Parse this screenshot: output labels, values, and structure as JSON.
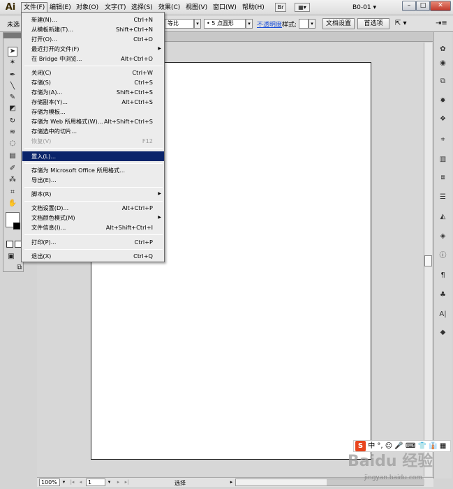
{
  "app": {
    "logo": "Ai",
    "workspace": "B0-01"
  },
  "menubar": {
    "items": [
      {
        "label": "文件(F)"
      },
      {
        "label": "编辑(E)"
      },
      {
        "label": "对象(O)"
      },
      {
        "label": "文字(T)"
      },
      {
        "label": "选择(S)"
      },
      {
        "label": "效果(C)"
      },
      {
        "label": "视图(V)"
      },
      {
        "label": "窗口(W)"
      },
      {
        "label": "帮助(H)"
      }
    ],
    "icons": [
      "bridge-icon",
      "arrange-documents-icon"
    ]
  },
  "window_controls": {
    "minimize": "–",
    "maximize": "□",
    "close": "✕"
  },
  "controlbar": {
    "selection_label": "未选",
    "stroke_profile": "等比",
    "brush": "• 5 点圆形",
    "opacity_label": "不透明度",
    "style_label": "样式:",
    "doc_setup_button": "文档设置",
    "preferences_button": "首选项"
  },
  "file_menu": {
    "items": [
      {
        "label": "新建(N)...",
        "shortcut": "Ctrl+N"
      },
      {
        "label": "从模板新建(T)...",
        "shortcut": "Shift+Ctrl+N"
      },
      {
        "label": "打开(O)...",
        "shortcut": "Ctrl+O"
      },
      {
        "label": "最近打开的文件(F)",
        "shortcut": "",
        "submenu": true
      },
      {
        "label": "在 Bridge 中浏览...",
        "shortcut": "Alt+Ctrl+O"
      },
      {
        "label": "关闭(C)",
        "shortcut": "Ctrl+W"
      },
      {
        "label": "存储(S)",
        "shortcut": "Ctrl+S"
      },
      {
        "label": "存储为(A)...",
        "shortcut": "Shift+Ctrl+S"
      },
      {
        "label": "存储副本(Y)...",
        "shortcut": "Alt+Ctrl+S"
      },
      {
        "label": "存储为模板...",
        "shortcut": ""
      },
      {
        "label": "存储为 Web 所用格式(W)...",
        "shortcut": "Alt+Shift+Ctrl+S"
      },
      {
        "label": "存储选中的切片...",
        "shortcut": ""
      },
      {
        "label": "恢复(V)",
        "shortcut": "F12",
        "disabled": true
      },
      {
        "label": "置入(L)...",
        "shortcut": "",
        "highlighted": true
      },
      {
        "label": "存储为 Microsoft Office 所用格式...",
        "shortcut": ""
      },
      {
        "label": "导出(E)...",
        "shortcut": ""
      },
      {
        "label": "脚本(R)",
        "shortcut": "",
        "submenu": true
      },
      {
        "label": "文档设置(D)...",
        "shortcut": "Alt+Ctrl+P"
      },
      {
        "label": "文档颜色模式(M)",
        "shortcut": "",
        "submenu": true
      },
      {
        "label": "文件信息(I)...",
        "shortcut": "Alt+Shift+Ctrl+I"
      },
      {
        "label": "打印(P)...",
        "shortcut": "Ctrl+P"
      },
      {
        "label": "退出(X)",
        "shortcut": "Ctrl+Q"
      }
    ]
  },
  "statusbar": {
    "zoom": "100%",
    "artboard_number": "1",
    "status_text": "选择"
  },
  "watermark": {
    "ime_logo": "S",
    "ime_text": "中 °, ☺ 🎤 ⌨ 👕 👔 ▦",
    "logo_text": "Baidu 经验",
    "url": "jingyan.baidu.com"
  }
}
